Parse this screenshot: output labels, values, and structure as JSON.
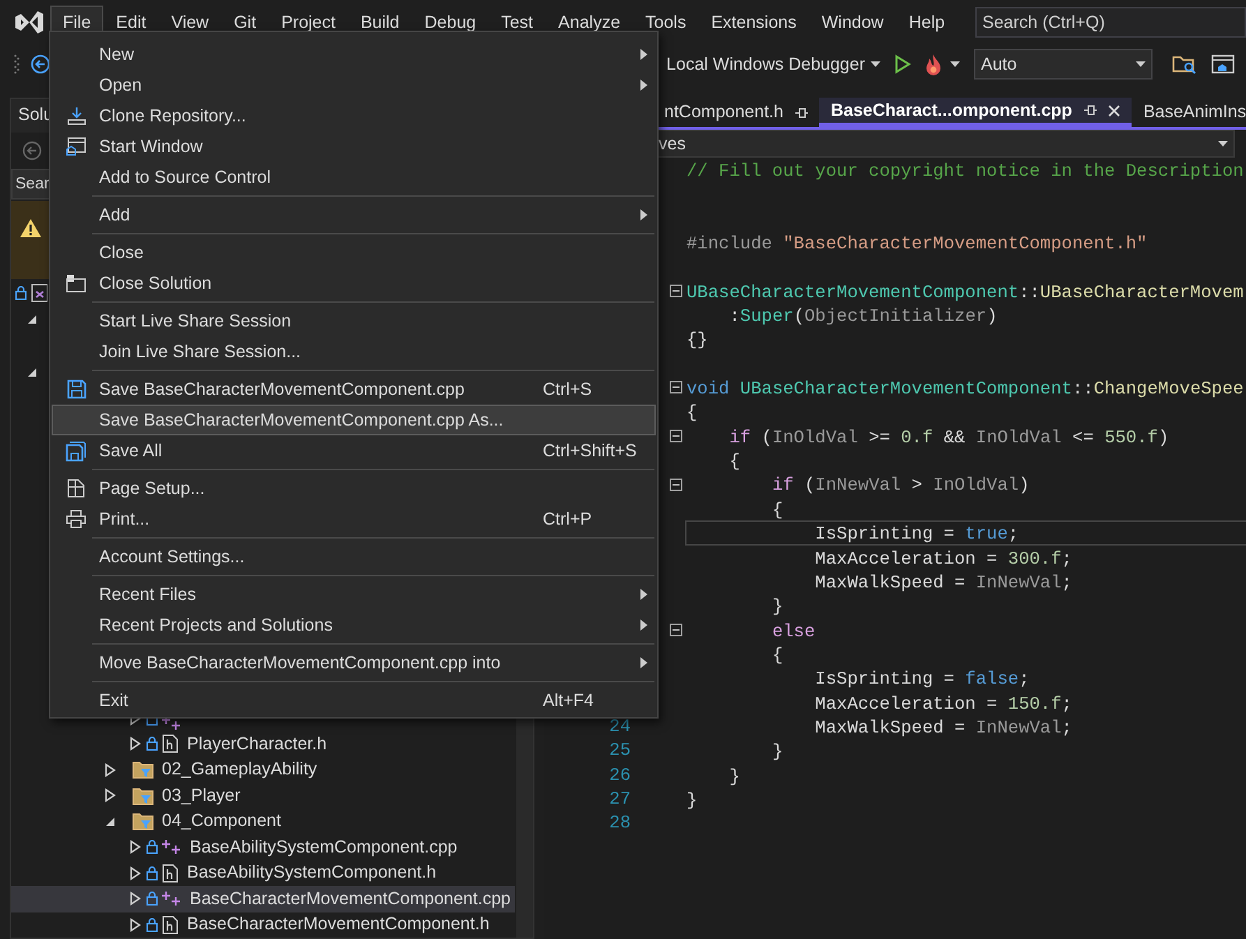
{
  "menubar": {
    "items": [
      {
        "label": "File",
        "selected": true
      },
      {
        "label": "Edit",
        "selected": false
      },
      {
        "label": "View",
        "selected": false
      },
      {
        "label": "Git",
        "selected": false
      },
      {
        "label": "Project",
        "selected": false
      },
      {
        "label": "Build",
        "selected": false
      },
      {
        "label": "Debug",
        "selected": false
      },
      {
        "label": "Test",
        "selected": false
      },
      {
        "label": "Analyze",
        "selected": false
      },
      {
        "label": "Tools",
        "selected": false
      },
      {
        "label": "Extensions",
        "selected": false
      },
      {
        "label": "Window",
        "selected": false
      },
      {
        "label": "Help",
        "selected": false
      }
    ],
    "search": {
      "placeholder": "Search (Ctrl+Q)"
    }
  },
  "toolbar": {
    "debugger": "Local Windows Debugger",
    "configuration": "Auto"
  },
  "solution_explorer": {
    "title": "Solu",
    "search": {
      "placeholder": "Sear"
    },
    "tree_top": [
      {
        "kind": "solution"
      },
      {
        "kind": "project",
        "expanded": true
      },
      {
        "kind": "project",
        "expanded": true
      }
    ],
    "tree": [
      {
        "children": [
          {
            "kind": "cpp",
            "expanded": false
          },
          {
            "label": "PlayerCharacter.h",
            "kind": "h",
            "expanded": false,
            "selected": false
          }
        ]
      },
      {
        "label": "02_GameplayAbility",
        "kind": "folder",
        "expanded": false,
        "selected": false
      },
      {
        "label": "03_Player",
        "kind": "folder",
        "expanded": false,
        "selected": false
      },
      {
        "label": "04_Component",
        "kind": "folder",
        "expanded": true,
        "selected": false,
        "children": [
          {
            "label": "BaseAbilitySystemComponent.cpp",
            "kind": "cpp",
            "expanded": false,
            "selected": false
          },
          {
            "label": "BaseAbilitySystemComponent.h",
            "kind": "h",
            "expanded": false,
            "selected": false
          },
          {
            "label": "BaseCharacterMovementComponent.cpp",
            "kind": "cpp",
            "expanded": false,
            "selected": true
          },
          {
            "label": "BaseCharacterMovementComponent.h",
            "kind": "h",
            "expanded": false,
            "selected": false
          }
        ]
      }
    ]
  },
  "editor": {
    "tabs": [
      {
        "label": "ntComponent.h",
        "selected": false
      },
      {
        "label": "BaseCharact...omponent.cpp",
        "selected": true
      },
      {
        "label": "BaseAnimIns",
        "selected": false
      }
    ],
    "nav_dropdown": "ves",
    "lines": [
      {
        "blank_after": true,
        "tokens": [
          {
            "kind": "comment",
            "text": "// Fill out your copyright notice in the Description"
          }
        ]
      },
      {
        "blank_before": true,
        "blank_after": true,
        "tokens": [
          {
            "kind": "preproc",
            "text": "#include "
          },
          {
            "kind": "string",
            "text": "\"BaseCharacterMovementComponent.h\""
          }
        ]
      },
      {
        "expanded": true,
        "tokens": [
          {
            "kind": "type",
            "text": "UBaseCharacterMovementComponent"
          },
          {
            "kind": "plain",
            "text": "::"
          },
          {
            "kind": "func",
            "text": "UBaseCharacterMovem"
          }
        ]
      },
      {
        "tokens": [
          {
            "kind": "plain",
            "text": "    :"
          },
          {
            "kind": "type",
            "text": "Super"
          },
          {
            "kind": "plain",
            "text": "("
          },
          {
            "kind": "param",
            "text": "ObjectInitializer"
          },
          {
            "kind": "plain",
            "text": ")"
          }
        ]
      },
      {
        "blank_after": true,
        "tokens": [
          {
            "kind": "plain",
            "text": "{}"
          }
        ]
      },
      {
        "expanded": true,
        "tokens": [
          {
            "kind": "keyword",
            "text": "void"
          },
          {
            "kind": "type",
            "text": " UBaseCharacterMovementComponent"
          },
          {
            "kind": "plain",
            "text": "::"
          },
          {
            "kind": "func",
            "text": "ChangeMoveSpee"
          }
        ]
      },
      {
        "tokens": [
          {
            "kind": "plain",
            "text": "{"
          }
        ]
      },
      {
        "expanded": true,
        "tokens": [
          {
            "kind": "control",
            "text": "    if"
          },
          {
            "kind": "plain",
            "text": " ("
          },
          {
            "kind": "param",
            "text": "InOldVal"
          },
          {
            "kind": "plain",
            "text": " >= "
          },
          {
            "kind": "number",
            "text": "0.f"
          },
          {
            "kind": "plain",
            "text": " && "
          },
          {
            "kind": "param",
            "text": "InOldVal"
          },
          {
            "kind": "plain",
            "text": " <= "
          },
          {
            "kind": "number",
            "text": "550.f"
          },
          {
            "kind": "plain",
            "text": ")"
          }
        ]
      },
      {
        "tokens": [
          {
            "kind": "plain",
            "text": "    {"
          }
        ]
      },
      {
        "expanded": true,
        "tokens": [
          {
            "kind": "control",
            "text": "        if"
          },
          {
            "kind": "plain",
            "text": " ("
          },
          {
            "kind": "param",
            "text": "InNewVal"
          },
          {
            "kind": "plain",
            "text": " > "
          },
          {
            "kind": "param",
            "text": "InOldVal"
          },
          {
            "kind": "plain",
            "text": ")"
          }
        ]
      },
      {
        "tokens": [
          {
            "kind": "plain",
            "text": "        {"
          }
        ]
      },
      {
        "current": true,
        "tokens": [
          {
            "kind": "plain",
            "text": "            IsSprinting = "
          },
          {
            "kind": "keyword",
            "text": "true"
          },
          {
            "kind": "plain",
            "text": ";"
          }
        ]
      },
      {
        "tokens": [
          {
            "kind": "plain",
            "text": "            MaxAcceleration = "
          },
          {
            "kind": "number",
            "text": "300.f"
          },
          {
            "kind": "plain",
            "text": ";"
          }
        ]
      },
      {
        "tokens": [
          {
            "kind": "plain",
            "text": "            MaxWalkSpeed = "
          },
          {
            "kind": "param",
            "text": "InNewVal"
          },
          {
            "kind": "plain",
            "text": ";"
          }
        ]
      },
      {
        "tokens": [
          {
            "kind": "plain",
            "text": "        }"
          }
        ]
      },
      {
        "expanded": true,
        "tokens": [
          {
            "kind": "control",
            "text": "        else"
          }
        ]
      },
      {
        "tokens": [
          {
            "kind": "plain",
            "text": "        {"
          }
        ]
      },
      {
        "tokens": [
          {
            "kind": "plain",
            "text": "            IsSprinting = "
          },
          {
            "kind": "keyword",
            "text": "false"
          },
          {
            "kind": "plain",
            "text": ";"
          }
        ]
      },
      {
        "tokens": [
          {
            "kind": "plain",
            "text": "            MaxAcceleration = "
          },
          {
            "kind": "number",
            "text": "150.f"
          },
          {
            "kind": "plain",
            "text": ";"
          }
        ]
      },
      {
        "number": "24",
        "tokens": [
          {
            "kind": "plain",
            "text": "            MaxWalkSpeed = "
          },
          {
            "kind": "param",
            "text": "InNewVal"
          },
          {
            "kind": "plain",
            "text": ";"
          }
        ]
      },
      {
        "number": "25",
        "tokens": [
          {
            "kind": "plain",
            "text": "        }"
          }
        ]
      },
      {
        "number": "26",
        "tokens": [
          {
            "kind": "plain",
            "text": "    }"
          }
        ]
      },
      {
        "number": "27",
        "tokens": [
          {
            "kind": "plain",
            "text": "}"
          }
        ]
      },
      {
        "number": "28"
      }
    ]
  },
  "file_menu": {
    "items": [
      {
        "kind": "item",
        "label": "New",
        "submenu": true,
        "highlighted": false
      },
      {
        "kind": "item",
        "label": "Open",
        "submenu": true,
        "highlighted": false
      },
      {
        "kind": "item",
        "label": "Clone Repository...",
        "highlighted": false
      },
      {
        "kind": "item",
        "label": "Start Window",
        "highlighted": false
      },
      {
        "kind": "item",
        "label": "Add to Source Control",
        "highlighted": false
      },
      {
        "kind": "separator"
      },
      {
        "kind": "item",
        "label": "Add",
        "submenu": true,
        "highlighted": false
      },
      {
        "kind": "separator"
      },
      {
        "kind": "item",
        "label": "Close",
        "highlighted": false
      },
      {
        "kind": "item",
        "label": "Close Solution",
        "highlighted": false
      },
      {
        "kind": "separator"
      },
      {
        "kind": "item",
        "label": "Start Live Share Session",
        "highlighted": false
      },
      {
        "kind": "item",
        "label": "Join Live Share Session...",
        "highlighted": false
      },
      {
        "kind": "separator"
      },
      {
        "kind": "item",
        "label": "Save BaseCharacterMovementComponent.cpp",
        "shortcut": "Ctrl+S",
        "highlighted": false
      },
      {
        "kind": "item",
        "label": "Save BaseCharacterMovementComponent.cpp As...",
        "highlighted": true
      },
      {
        "kind": "item",
        "label": "Save All",
        "shortcut": "Ctrl+Shift+S",
        "highlighted": false
      },
      {
        "kind": "separator"
      },
      {
        "kind": "item",
        "label": "Page Setup...",
        "highlighted": false
      },
      {
        "kind": "item",
        "label": "Print...",
        "shortcut": "Ctrl+P",
        "highlighted": false
      },
      {
        "kind": "separator"
      },
      {
        "kind": "item",
        "label": "Account Settings...",
        "highlighted": false
      },
      {
        "kind": "separator"
      },
      {
        "kind": "item",
        "label": "Recent Files",
        "submenu": true,
        "highlighted": false
      },
      {
        "kind": "item",
        "label": "Recent Projects and Solutions",
        "submenu": true,
        "highlighted": false
      },
      {
        "kind": "separator"
      },
      {
        "kind": "item",
        "label": "Move BaseCharacterMovementComponent.cpp into",
        "submenu": true,
        "highlighted": false
      },
      {
        "kind": "separator"
      },
      {
        "kind": "item",
        "label": "Exit",
        "shortcut": "Alt+F4",
        "highlighted": false
      }
    ]
  }
}
